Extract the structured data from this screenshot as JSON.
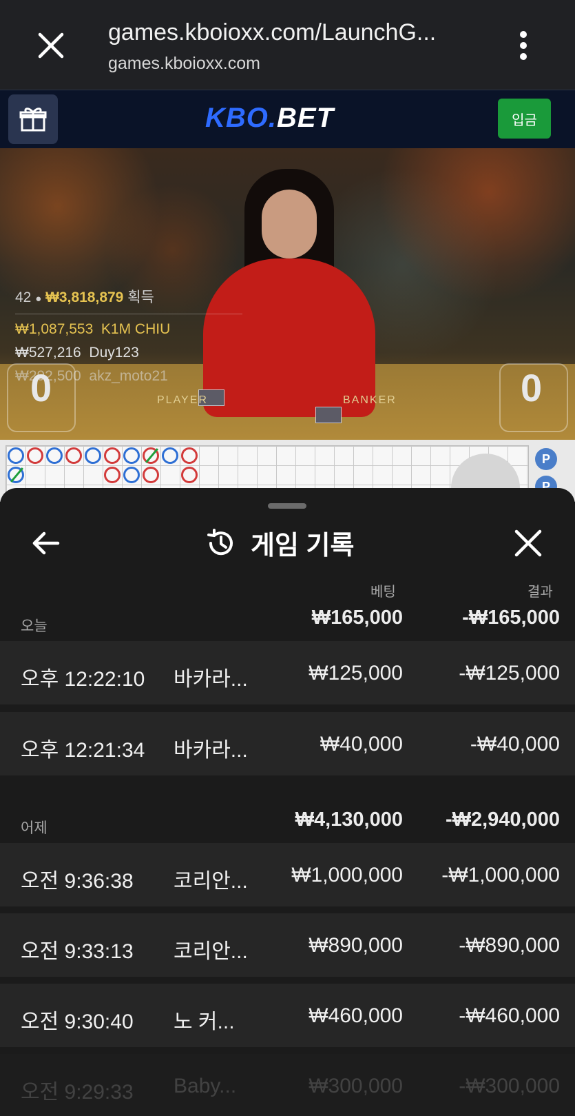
{
  "browser": {
    "url_title": "games.kboioxx.com/LaunchG...",
    "url_domain": "games.kboioxx.com"
  },
  "site": {
    "logo_part1": "KBO.",
    "logo_part2": "BET",
    "deposit_label": "입금"
  },
  "video": {
    "winners_count": "42",
    "winners_total": "₩3,818,879",
    "winners_suffix": "획득",
    "winners": [
      {
        "amount": "₩1,087,553",
        "name": "K1M CHIU"
      },
      {
        "amount": "₩527,216",
        "name": "Duy123"
      },
      {
        "amount": "₩292,500",
        "name": "akz_moto21"
      }
    ],
    "player_score": "0",
    "banker_score": "0",
    "table_player": "PLAYER",
    "table_banker": "BANKER"
  },
  "roadmap": {
    "p_label": "P"
  },
  "sheet": {
    "title": "게임 기록",
    "col_bet": "베팅",
    "col_result": "결과",
    "groups": [
      {
        "label": "오늘",
        "bet_total": "₩165,000",
        "result_total": "-₩165,000",
        "rows": [
          {
            "time": "오후 12:22:10",
            "game": "바카라...",
            "bet": "₩125,000",
            "result": "-₩125,000"
          },
          {
            "time": "오후 12:21:34",
            "game": "바카라...",
            "bet": "₩40,000",
            "result": "-₩40,000"
          }
        ]
      },
      {
        "label": "어제",
        "bet_total": "₩4,130,000",
        "result_total": "-₩2,940,000",
        "rows": [
          {
            "time": "오전 9:36:38",
            "game": "코리안...",
            "bet": "₩1,000,000",
            "result": "-₩1,000,000"
          },
          {
            "time": "오전 9:33:13",
            "game": "코리안...",
            "bet": "₩890,000",
            "result": "-₩890,000"
          },
          {
            "time": "오전 9:30:40",
            "game": "노 커...",
            "bet": "₩460,000",
            "result": "-₩460,000"
          },
          {
            "time": "오전 9:29:33",
            "game": "Baby...",
            "bet": "₩300,000",
            "result": "-₩300,000"
          }
        ]
      }
    ]
  },
  "icons": {
    "close": "close-icon",
    "menu": "more-vert-icon",
    "gift": "gift-icon",
    "back": "arrow-left-icon",
    "history": "history-icon"
  }
}
